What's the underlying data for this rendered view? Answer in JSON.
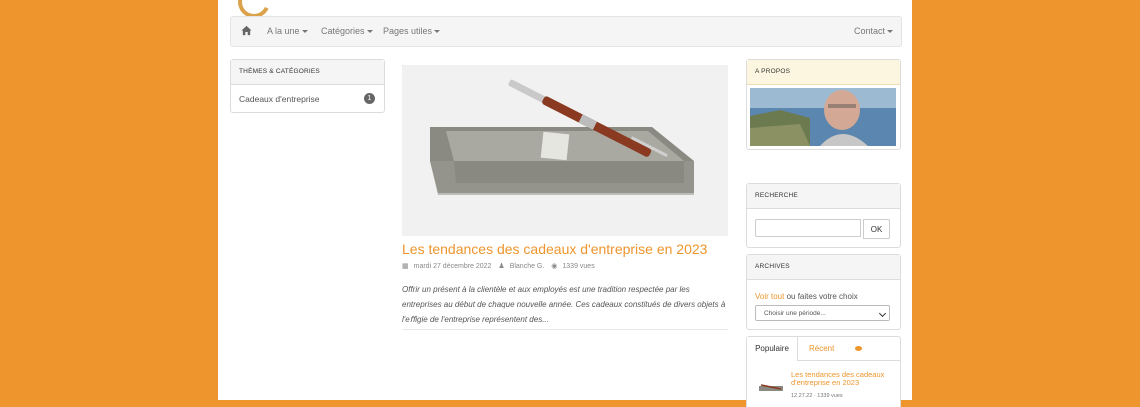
{
  "nav": {
    "home_icon": "home-icon",
    "items": [
      {
        "label": "A la une"
      },
      {
        "label": "Catégories"
      },
      {
        "label": "Pages utiles"
      }
    ],
    "contact": "Contact"
  },
  "categories": {
    "heading": "THÈMES & CATÉGORIES",
    "items": [
      {
        "label": "Cadeaux d'entreprise",
        "count": "1"
      }
    ]
  },
  "article": {
    "title": "Les tendances des cadeaux d'entreprise en 2023",
    "date": "mardi 27 décembre 2022",
    "author": "Blanche G.",
    "views": "1339 vues",
    "excerpt": "O﻿ffrir un présent à la clientèle et aux employés est une tradition respectée par les entreprises au début de chaque nouvelle année. Ces cadeaux constitués de divers objets à l'eﬀigie de l'entreprise représentent des..."
  },
  "sidebar": {
    "about_heading": "A PROPOS",
    "search_heading": "RECHERCHE",
    "search_placeholder": "",
    "search_button": "OK",
    "archives_heading": "ARCHIVES",
    "archives_link": "Voir tout",
    "archives_text": " ou faites votre choix",
    "archives_select": "Choisir une période...",
    "tabs": {
      "popular": "Populaire",
      "recent": "Récent",
      "comments_icon": "comment-icon"
    },
    "popular_item": {
      "title": "Les tendances des cadeaux d'entreprise en 2023",
      "meta": "12.27.22 · 1339 vues"
    }
  },
  "colors": {
    "accent": "#ee952d",
    "background": "#ee952d",
    "page": "#ffffff"
  }
}
